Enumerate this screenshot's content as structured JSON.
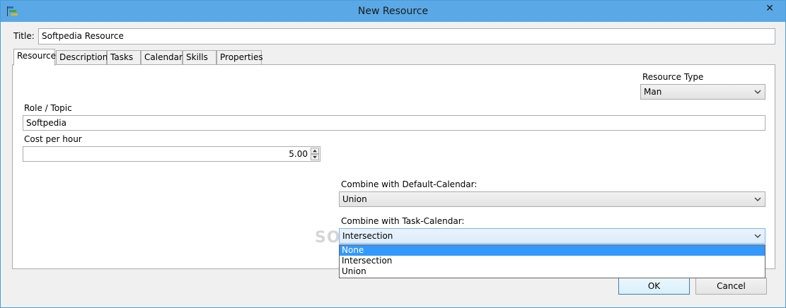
{
  "window": {
    "title": "New Resource",
    "close_glyph": "✕"
  },
  "title_field": {
    "label": "Title:",
    "value": "Softpedia Resource"
  },
  "tabs": [
    {
      "label": "Resource"
    },
    {
      "label": "Description"
    },
    {
      "label": "Tasks"
    },
    {
      "label": "Calendar"
    },
    {
      "label": "Skills"
    },
    {
      "label": "Properties"
    }
  ],
  "resource_tab": {
    "resource_type_label": "Resource Type",
    "resource_type_value": "Man",
    "role_label": "Role / Topic",
    "role_value": "Softpedia",
    "cost_label": "Cost per hour",
    "cost_value": "5.00",
    "default_cal_label": "Combine with Default-Calendar:",
    "default_cal_value": "Union",
    "task_cal_label": "Combine with Task-Calendar:",
    "task_cal_value": "Intersection",
    "task_cal_options": [
      "None",
      "Intersection",
      "Union"
    ]
  },
  "buttons": {
    "ok": "OK",
    "cancel": "Cancel"
  },
  "watermark": "SOFTPEDIA",
  "colors": {
    "titlebar": "#5aa9e6",
    "selection": "#3399ff"
  },
  "icons": {
    "app": "gantt-app-icon",
    "chevron": "chevron-down-icon",
    "spin_up": "arrow-up-icon",
    "spin_down": "arrow-down-icon"
  }
}
